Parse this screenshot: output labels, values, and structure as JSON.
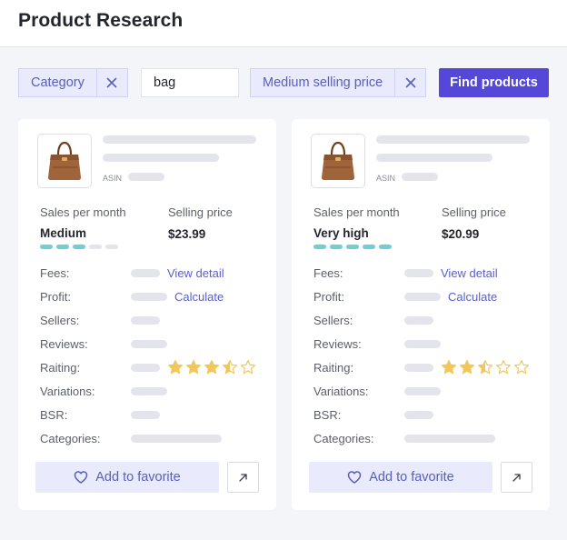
{
  "header": {
    "title": "Product Research"
  },
  "filters": {
    "category_label": "Category",
    "search_value": "bag",
    "price_label": "Medium selling price",
    "find_label": "Find products"
  },
  "cards": [
    {
      "asin_label": "ASIN",
      "sales_label": "Sales per month",
      "sales_value": "Medium",
      "sales_level": 3,
      "sales_level_max": 5,
      "price_label": "Selling price",
      "price_value": "$23.99",
      "fees_label": "Fees:",
      "fees_link": "View detail",
      "profit_label": "Profit:",
      "profit_link": "Calculate",
      "sellers_label": "Sellers:",
      "reviews_label": "Reviews:",
      "rating_label": "Raiting:",
      "rating": 3.5,
      "variations_label": "Variations:",
      "bsr_label": "BSR:",
      "categories_label": "Categories:",
      "favorite_label": "Add to favorite"
    },
    {
      "asin_label": "ASIN",
      "sales_label": "Sales per month",
      "sales_value": "Very high",
      "sales_level": 5,
      "sales_level_max": 5,
      "price_label": "Selling price",
      "price_value": "$20.99",
      "fees_label": "Fees:",
      "fees_link": "View detail",
      "profit_label": "Profit:",
      "profit_link": "Calculate",
      "sellers_label": "Sellers:",
      "reviews_label": "Reviews:",
      "rating_label": "Raiting:",
      "rating": 2.5,
      "variations_label": "Variations:",
      "bsr_label": "BSR:",
      "categories_label": "Categories:",
      "favorite_label": "Add to favorite"
    }
  ],
  "icons": {
    "chip_remove": "close-icon",
    "favorite": "heart-icon",
    "external": "arrow-up-right-icon",
    "product": "handbag-icon",
    "rating": "star-icon"
  },
  "colors": {
    "accent": "#5548d9",
    "chip_bg": "#e9eafb",
    "meter_on": "#6fcfd9",
    "star": "#f1c75b",
    "link": "#5a5fc8"
  }
}
